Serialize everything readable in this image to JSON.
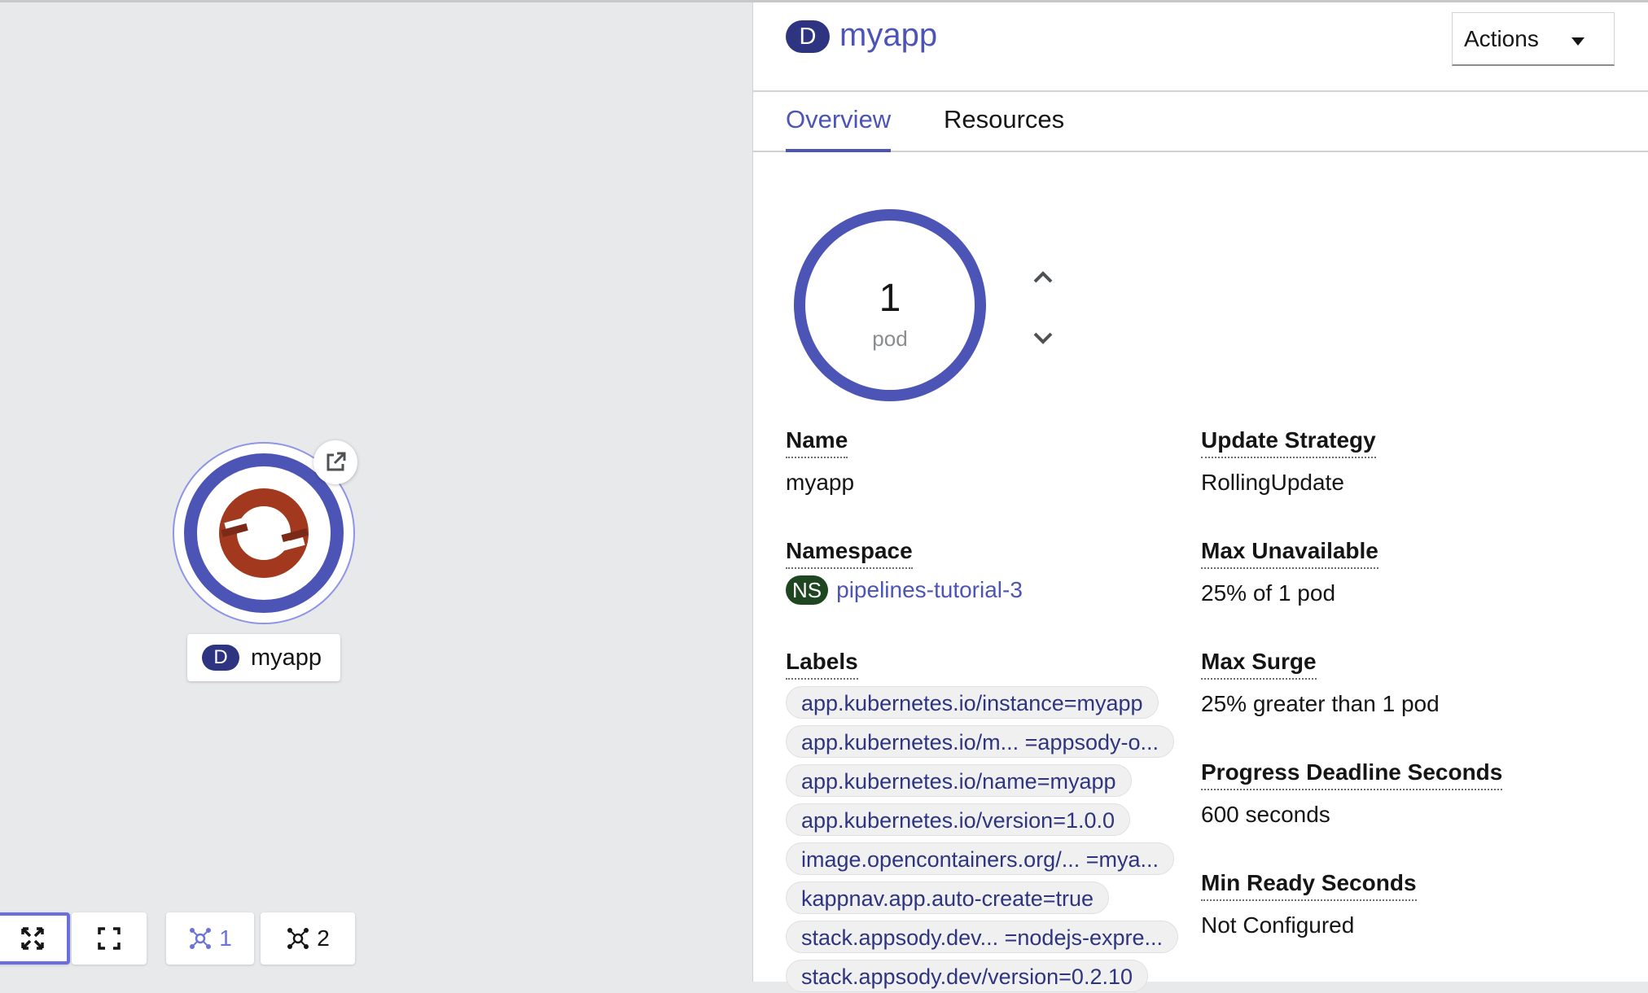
{
  "node": {
    "badge": "D",
    "name": "myapp"
  },
  "controls": {
    "expand_all": "expand-icon",
    "fit": "fit-to-screen-icon",
    "group1": {
      "icon": "topology-icon",
      "count": "1"
    },
    "group2": {
      "icon": "topology-icon",
      "count": "2"
    }
  },
  "panel": {
    "badge": "D",
    "title": "myapp",
    "actions_label": "Actions",
    "tabs": [
      {
        "label": "Overview"
      },
      {
        "label": "Resources"
      }
    ],
    "pods": {
      "count": "1",
      "unit": "pod"
    },
    "fields": {
      "name": {
        "label": "Name",
        "value": "myapp"
      },
      "namespace": {
        "label": "Namespace",
        "badge": "NS",
        "value": "pipelines-tutorial-3"
      },
      "labels": {
        "label": "Labels"
      },
      "update_strategy": {
        "label": "Update Strategy",
        "value": "RollingUpdate"
      },
      "max_unavailable": {
        "label": "Max Unavailable",
        "value": "25% of 1 pod"
      },
      "max_surge": {
        "label": "Max Surge",
        "value": "25% greater than 1 pod"
      },
      "progress_deadline": {
        "label": "Progress Deadline Seconds",
        "value": "600 seconds"
      },
      "min_ready": {
        "label": "Min Ready Seconds",
        "value": "Not Configured"
      }
    },
    "label_chips": [
      "app.kubernetes.io/instance=myapp",
      "app.kubernetes.io/m... =appsody-o...",
      "app.kubernetes.io/name=myapp",
      "app.kubernetes.io/version=1.0.0",
      "image.opencontainers.org/... =mya...",
      "kappnav.app.auto-create=true",
      "stack.appsody.dev... =nodejs-expre...",
      "stack.appsody.dev/version=0.2.10"
    ]
  },
  "colors": {
    "accent": "#4c55b6",
    "deployment_badge": "#2f3480",
    "namespace_badge": "#1e4620",
    "openshift_logo": "#a2391f"
  }
}
